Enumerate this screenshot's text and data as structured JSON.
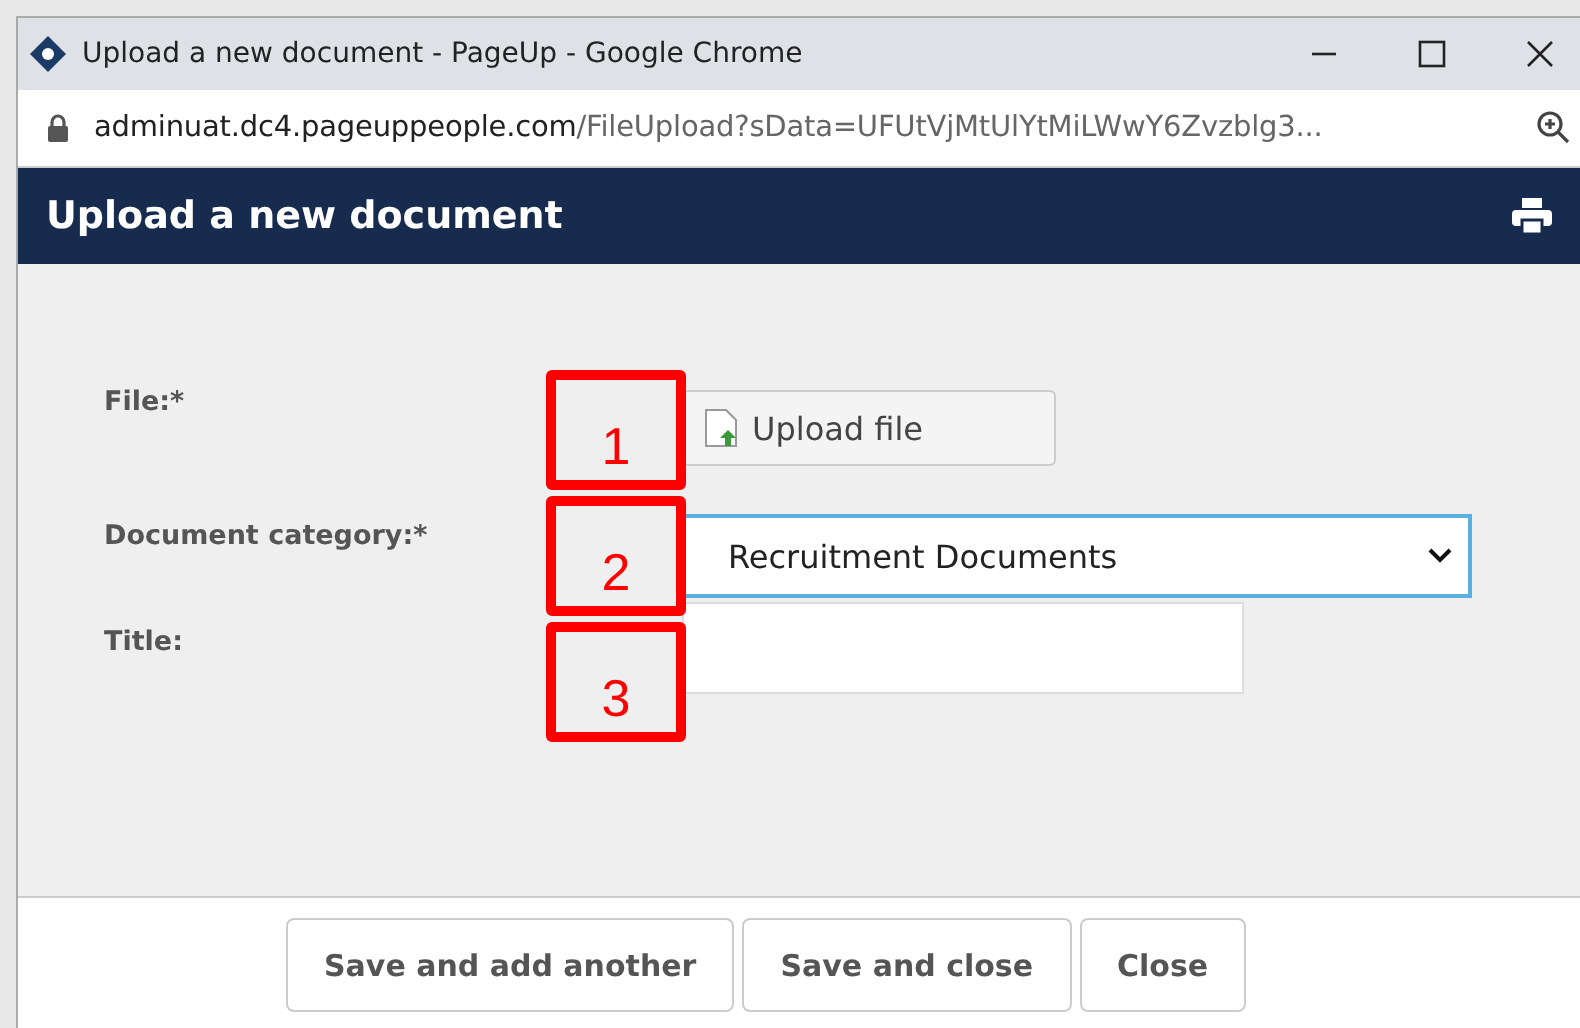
{
  "window": {
    "title": "Upload a new document - PageUp - Google Chrome"
  },
  "address_bar": {
    "host": "adminuat.dc4.pageuppeople.com",
    "path": "/FileUpload?sData=UFUtVjMtUlYtMiLWwY6Zvzblg3..."
  },
  "header": {
    "title": "Upload a new document"
  },
  "form": {
    "fields": [
      {
        "kind": "upload",
        "label": "File:*",
        "button": "Upload file"
      },
      {
        "kind": "select",
        "label": "Document category:*",
        "value": "Recruitment Documents",
        "focused": true
      },
      {
        "kind": "text",
        "label": "Title:"
      }
    ]
  },
  "annotations": [
    {
      "number": "1"
    },
    {
      "number": "2"
    },
    {
      "number": "3"
    }
  ],
  "buttons": [
    "Save and add another",
    "Save and close",
    "Close"
  ]
}
